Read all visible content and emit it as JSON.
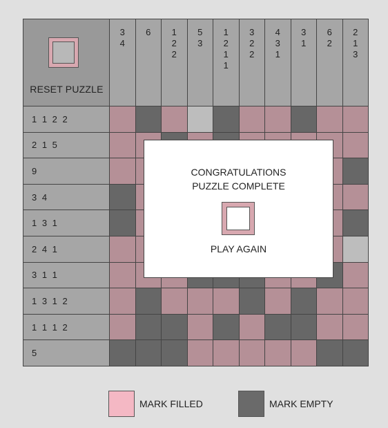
{
  "reset_label": "RESET PUZZLE",
  "column_clues": [
    "3\n4",
    "6",
    "1\n2\n2",
    "5\n3",
    "1\n2\n1\n1",
    "3\n2\n2",
    "4\n3\n1",
    "3\n1",
    "6\n2",
    "2\n1\n3"
  ],
  "row_clues": [
    "1 1 2 2",
    "2 1 5",
    "9",
    "3 4",
    "1 3 1",
    "2 4 1",
    "3 1 1",
    "1 3 1 2",
    "1 1 1 2",
    "5"
  ],
  "grid": [
    [
      "F",
      "E",
      "F",
      "U",
      "E",
      "F",
      "F",
      "E",
      "F",
      "F"
    ],
    [
      "F",
      "F",
      "E",
      "F",
      "E",
      "F",
      "F",
      "F",
      "F",
      "F"
    ],
    [
      "F",
      "F",
      "F",
      "F",
      "F",
      "F",
      "F",
      "F",
      "F",
      "E"
    ],
    [
      "E",
      "F",
      "F",
      "F",
      "E",
      "F",
      "F",
      "F",
      "F",
      "F"
    ],
    [
      "E",
      "F",
      "E",
      "F",
      "F",
      "F",
      "E",
      "F",
      "F",
      "E"
    ],
    [
      "F",
      "F",
      "E",
      "F",
      "F",
      "F",
      "F",
      "E",
      "F",
      "U"
    ],
    [
      "F",
      "F",
      "F",
      "E",
      "E",
      "E",
      "F",
      "F",
      "E",
      "F"
    ],
    [
      "F",
      "E",
      "F",
      "F",
      "F",
      "E",
      "F",
      "E",
      "F",
      "F"
    ],
    [
      "F",
      "E",
      "E",
      "F",
      "E",
      "F",
      "E",
      "E",
      "F",
      "F"
    ],
    [
      "E",
      "E",
      "E",
      "F",
      "F",
      "F",
      "F",
      "F",
      "E",
      "E"
    ]
  ],
  "colors": {
    "filled": "#b59097",
    "empty": "#676767",
    "unknown": "#bdbdbd",
    "legend_filled": "#f4b8c4",
    "legend_empty": "#6a6a6a"
  },
  "overlay": {
    "line1": "CONGRATULATIONS",
    "line2": "PUZZLE COMPLETE",
    "play_again": "PLAY AGAIN"
  },
  "legend": {
    "filled_label": "MARK FILLED",
    "empty_label": "MARK EMPTY"
  }
}
